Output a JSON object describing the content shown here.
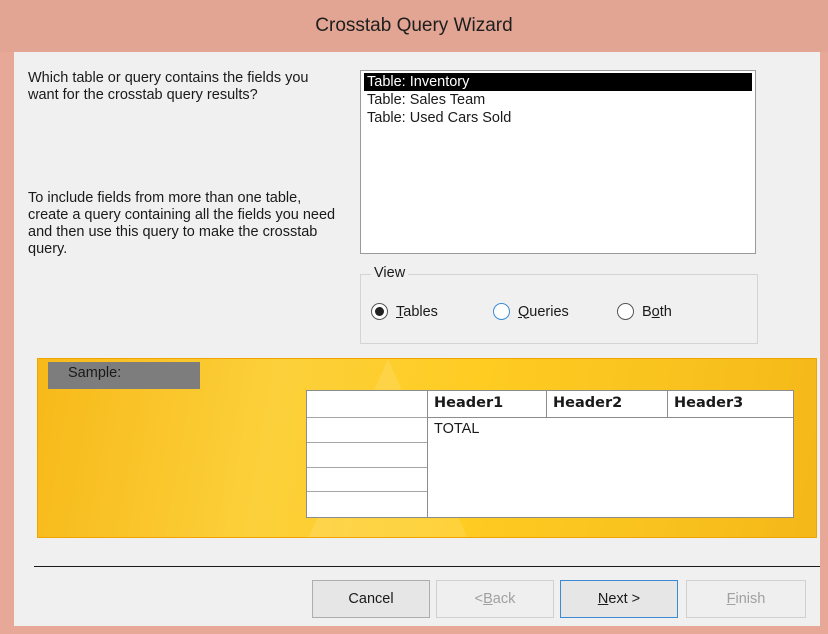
{
  "window": {
    "title": "Crosstab Query Wizard"
  },
  "instructions": {
    "question": "Which table or query contains the fields you want for the crosstab query results?",
    "hint": "To include fields from more than one table, create a query containing all the fields you need and then use this query to make the crosstab query."
  },
  "source_list": {
    "items": [
      "Table: Inventory",
      "Table: Sales Team",
      "Table: Used Cars Sold"
    ],
    "selected": "Table: Inventory"
  },
  "view": {
    "legend": "View",
    "options": [
      {
        "pre": "",
        "key": "T",
        "post": "ables",
        "checked": true
      },
      {
        "pre": "",
        "key": "Q",
        "post": "ueries",
        "checked": false
      },
      {
        "pre": "B",
        "key": "o",
        "post": "th",
        "checked": false
      }
    ]
  },
  "sample": {
    "label": "Sample:",
    "headers": [
      "Header1",
      "Header2",
      "Header3"
    ],
    "total": "TOTAL"
  },
  "buttons": {
    "cancel": "Cancel",
    "back": {
      "pre": "< ",
      "key": "B",
      "post": "ack"
    },
    "next": {
      "pre": "",
      "key": "N",
      "post": "ext >"
    },
    "finish": {
      "pre": "",
      "key": "F",
      "post": "inish"
    }
  },
  "colors": {
    "titlebar": "#e2a493",
    "selection": "#000000",
    "sample_bg": "#fcd03a",
    "focus": "#3c8ad4"
  }
}
